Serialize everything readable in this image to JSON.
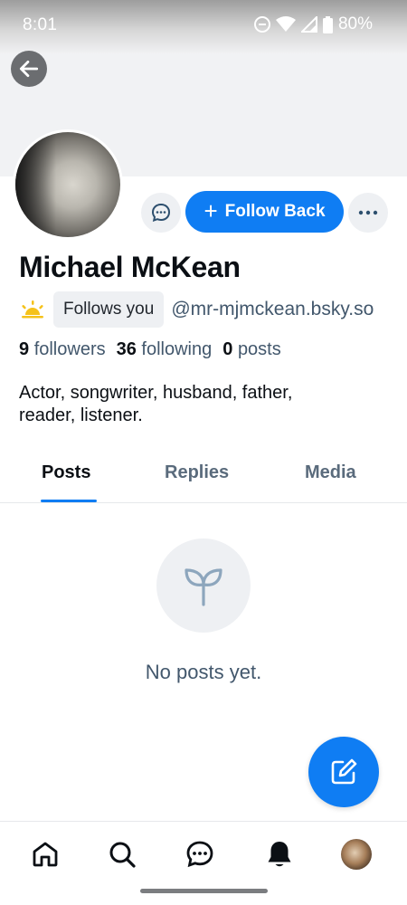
{
  "status_bar": {
    "time": "8:01",
    "battery": "80%"
  },
  "profile": {
    "display_name": "Michael McKean",
    "follows_you_label": "Follows you",
    "handle": "@mr-mjmckean.bsky.so",
    "followers_count": "9",
    "followers_label": "followers",
    "following_count": "36",
    "following_label": "following",
    "posts_count": "0",
    "posts_label": "posts",
    "bio_line1": "Actor, songwriter, husband, father,",
    "bio_line2": "reader, listener."
  },
  "actions": {
    "follow_back_label": "Follow Back"
  },
  "tabs": [
    {
      "label": "Posts",
      "active": true
    },
    {
      "label": "Replies",
      "active": false
    },
    {
      "label": "Media",
      "active": false
    }
  ],
  "empty_state": {
    "message": "No posts yet."
  },
  "icons": {
    "back": "arrow-left-icon",
    "message": "chat-bubble-icon",
    "more": "ellipsis-icon",
    "sun": "sunrise-icon",
    "empty": "sprout-icon",
    "compose": "compose-icon",
    "nav": [
      "home-icon",
      "search-icon",
      "chat-icon",
      "bell-icon",
      "profile-avatar"
    ]
  },
  "colors": {
    "accent": "#0f7df3",
    "muted_text": "#42576c",
    "chip_bg": "#eef0f3"
  }
}
